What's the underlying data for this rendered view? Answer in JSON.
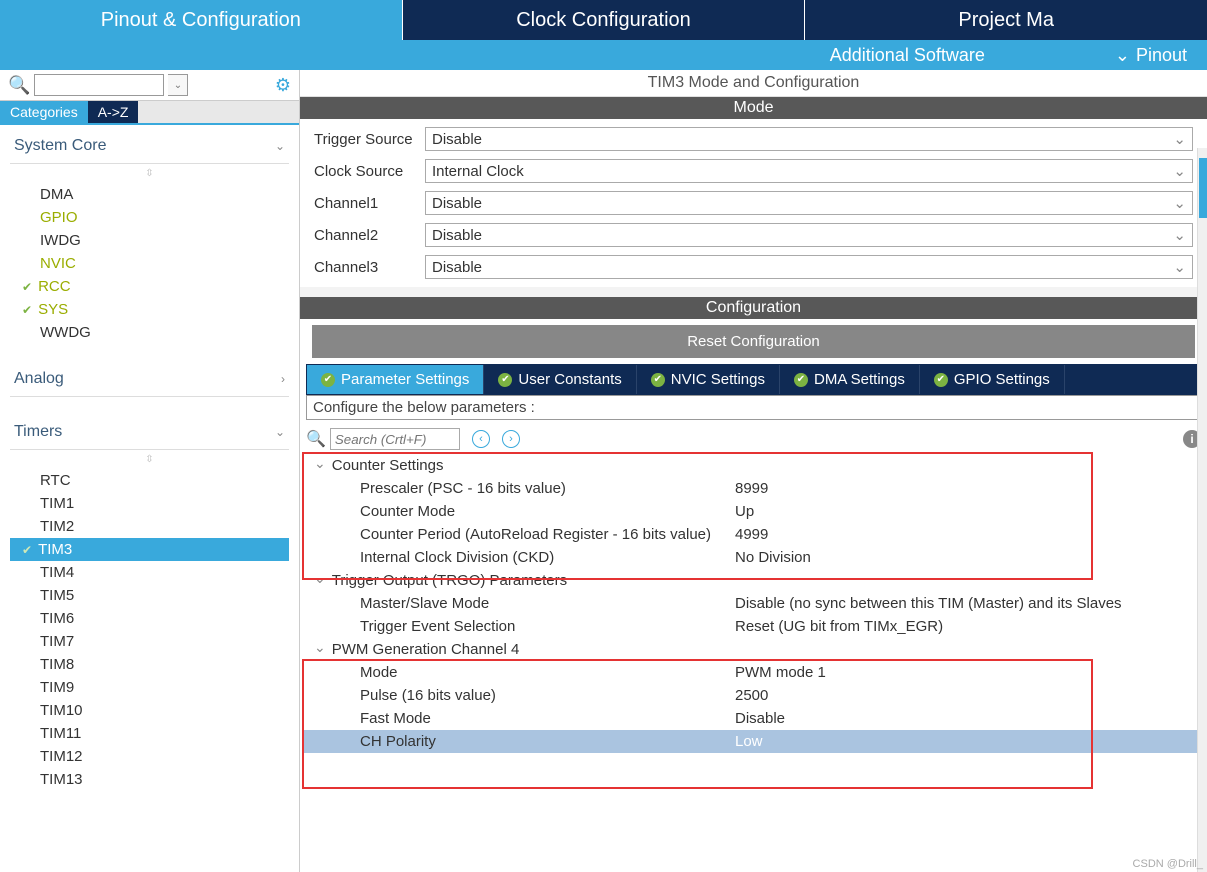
{
  "topbar": {
    "tabs": [
      "Pinout & Configuration",
      "Clock Configuration",
      "Project Ma"
    ]
  },
  "subbar": {
    "additional": "Additional Software",
    "pinout": "Pinout"
  },
  "sidebar": {
    "search": {
      "placeholder": ""
    },
    "cat_tabs": {
      "categories": "Categories",
      "az": "A->Z"
    },
    "sections": {
      "system_core": {
        "title": "System Core",
        "items": [
          "DMA",
          "GPIO",
          "IWDG",
          "NVIC",
          "RCC",
          "SYS",
          "WWDG"
        ]
      },
      "analog": {
        "title": "Analog"
      },
      "timers": {
        "title": "Timers",
        "items": [
          "RTC",
          "TIM1",
          "TIM2",
          "TIM3",
          "TIM4",
          "TIM5",
          "TIM6",
          "TIM7",
          "TIM8",
          "TIM9",
          "TIM10",
          "TIM11",
          "TIM12",
          "TIM13"
        ]
      }
    }
  },
  "content": {
    "panel_title": "TIM3 Mode and Configuration",
    "mode": {
      "title": "Mode",
      "rows": [
        {
          "label": "Trigger Source",
          "value": "Disable"
        },
        {
          "label": "Clock Source",
          "value": "Internal Clock"
        },
        {
          "label": "Channel1",
          "value": "Disable"
        },
        {
          "label": "Channel2",
          "value": "Disable"
        },
        {
          "label": "Channel3",
          "value": "Disable"
        }
      ]
    },
    "config": {
      "title": "Configuration",
      "reset": "Reset Configuration",
      "tabs": [
        "Parameter Settings",
        "User Constants",
        "NVIC Settings",
        "DMA Settings",
        "GPIO Settings"
      ],
      "configure_line": "Configure the below parameters :",
      "search_placeholder": "Search (Crtl+F)",
      "groups": [
        {
          "title": "Counter Settings",
          "rows": [
            {
              "name": "Prescaler (PSC - 16 bits value)",
              "value": "8999"
            },
            {
              "name": "Counter Mode",
              "value": "Up"
            },
            {
              "name": "Counter Period (AutoReload Register - 16 bits value)",
              "value": "4999"
            },
            {
              "name": "Internal Clock Division (CKD)",
              "value": "No Division"
            }
          ]
        },
        {
          "title": "Trigger Output (TRGO) Parameters",
          "rows": [
            {
              "name": "Master/Slave Mode",
              "value": "Disable (no sync between this TIM (Master) and its Slaves"
            },
            {
              "name": "Trigger Event Selection",
              "value": "Reset (UG bit from TIMx_EGR)"
            }
          ]
        },
        {
          "title": "PWM Generation Channel 4",
          "rows": [
            {
              "name": "Mode",
              "value": "PWM mode 1"
            },
            {
              "name": "Pulse (16 bits value)",
              "value": "2500"
            },
            {
              "name": "Fast Mode",
              "value": "Disable"
            },
            {
              "name": "CH Polarity",
              "value": "Low"
            }
          ]
        }
      ]
    }
  },
  "watermark": "CSDN @Drill_"
}
